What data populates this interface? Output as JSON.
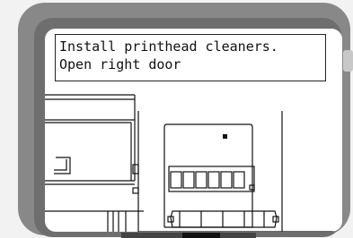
{
  "panel": {
    "message_line_1": "Install printhead cleaners.",
    "message_line_2": "Open right door"
  },
  "colors": {
    "bezel": "#888888",
    "bezel_inner": "#6e6e6e",
    "screen": "#ffffff",
    "ink": "#111111"
  },
  "icons": {
    "illustration": "printer-right-door-cleaners-illustration"
  }
}
